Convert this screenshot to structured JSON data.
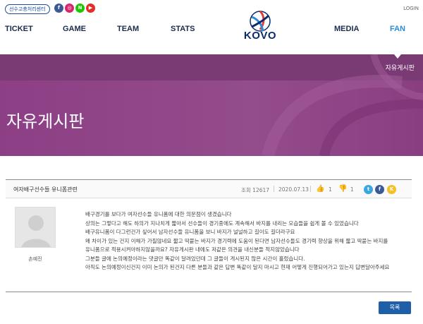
{
  "header": {
    "center_link": "선수고충처리센터",
    "login": "LOGIN",
    "logo_text": "KOVO",
    "nav": [
      {
        "label": "TICKET"
      },
      {
        "label": "GAME"
      },
      {
        "label": "TEAM"
      },
      {
        "label": "STATS"
      },
      {
        "label": "MEDIA"
      },
      {
        "label": "FAN",
        "active": true
      }
    ],
    "sns_icons": [
      "facebook-icon",
      "instagram-icon",
      "naver-icon",
      "youtube-icon"
    ]
  },
  "banner": {
    "breadcrumb": "자유게시판",
    "title": "자유게시판",
    "color": "#8d3f85"
  },
  "post": {
    "title": "여자배구선수들 유니폼관련",
    "views": "조회 12617",
    "date": "2020.07.13",
    "likes": "1",
    "dislikes": "1",
    "author": "손예진",
    "body": [
      "배구경기를 보다가 여자선수들 유니폼에 대한 의문점이 생겼습니다",
      "상의는 그렇다고 해도 하의가 지나치게 짧아서 선수들이 경기중에도 계속해서 바지를 내리는 모습들을 쉽게 볼 수 있었습니다",
      "배구유니폼이 다그런건가 싶어서 남자선수들 유니폼을 보니 바지가 널널하고 길이도 길더라구요",
      "왜 차이가 있는 건지 이해가 가질않네요 짧고 딱붙는 바지가 경기력에 도움이 된다면 남자선수들도 경기력 향상을 위해 짧고 딱붙는 바지를",
      "유니폼으로 적용시켜야하지않을까요? 자유게시판 내에도 저같은 의견을 내신분들 적지않았습니다",
      "그분들 글에 논의예정이라는 댓글만 똑같이 달려있던데 그 글들이 게시된지 많은 시간이 흘렀습니다.",
      "아직도 논의예정이신건지 이미 논의가 된건지 다른 분들과 같은 답변 똑같이 달지 마시고 현재 어떻게 진행되어가고 있는지 답변달아주세요"
    ],
    "list_button": "목록"
  },
  "colors": {
    "brand_navy": "#0a2c6b",
    "accent_blue": "#2a8bd6",
    "banner_purple": "#8d3f85",
    "button_blue": "#1f5fa8"
  }
}
